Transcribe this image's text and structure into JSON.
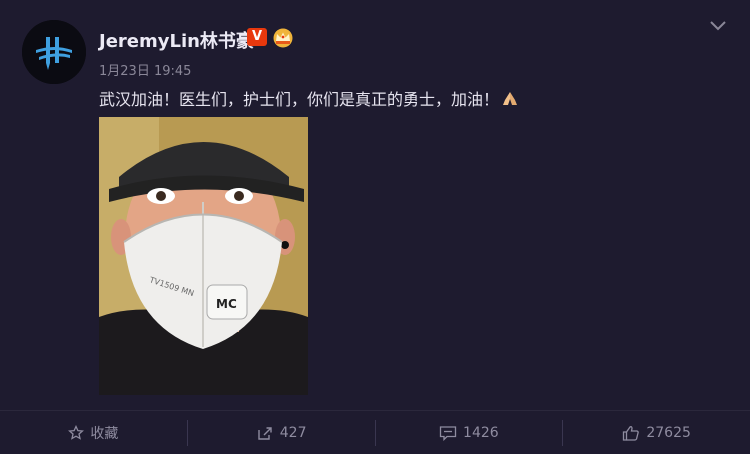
{
  "post": {
    "author": "JeremyLin林书豪",
    "badges": {
      "verified_label": "V",
      "verified_color": "#e8380d",
      "crown_icon": "crown-icon"
    },
    "timestamp": "1月23日 19:45",
    "text": "武汉加油！医生们，护士们，你们是真正的勇士，加油！",
    "emoji": "folded-hands-icon"
  },
  "actions": {
    "favorite_label": "收藏",
    "repost_count": "427",
    "comment_count": "1426",
    "like_count": "27625"
  },
  "theme": {
    "background": "#1e1b2f",
    "text": "#e6e4ef",
    "muted": "#8f8ca0",
    "accent_blue": "#3fa0e0"
  }
}
